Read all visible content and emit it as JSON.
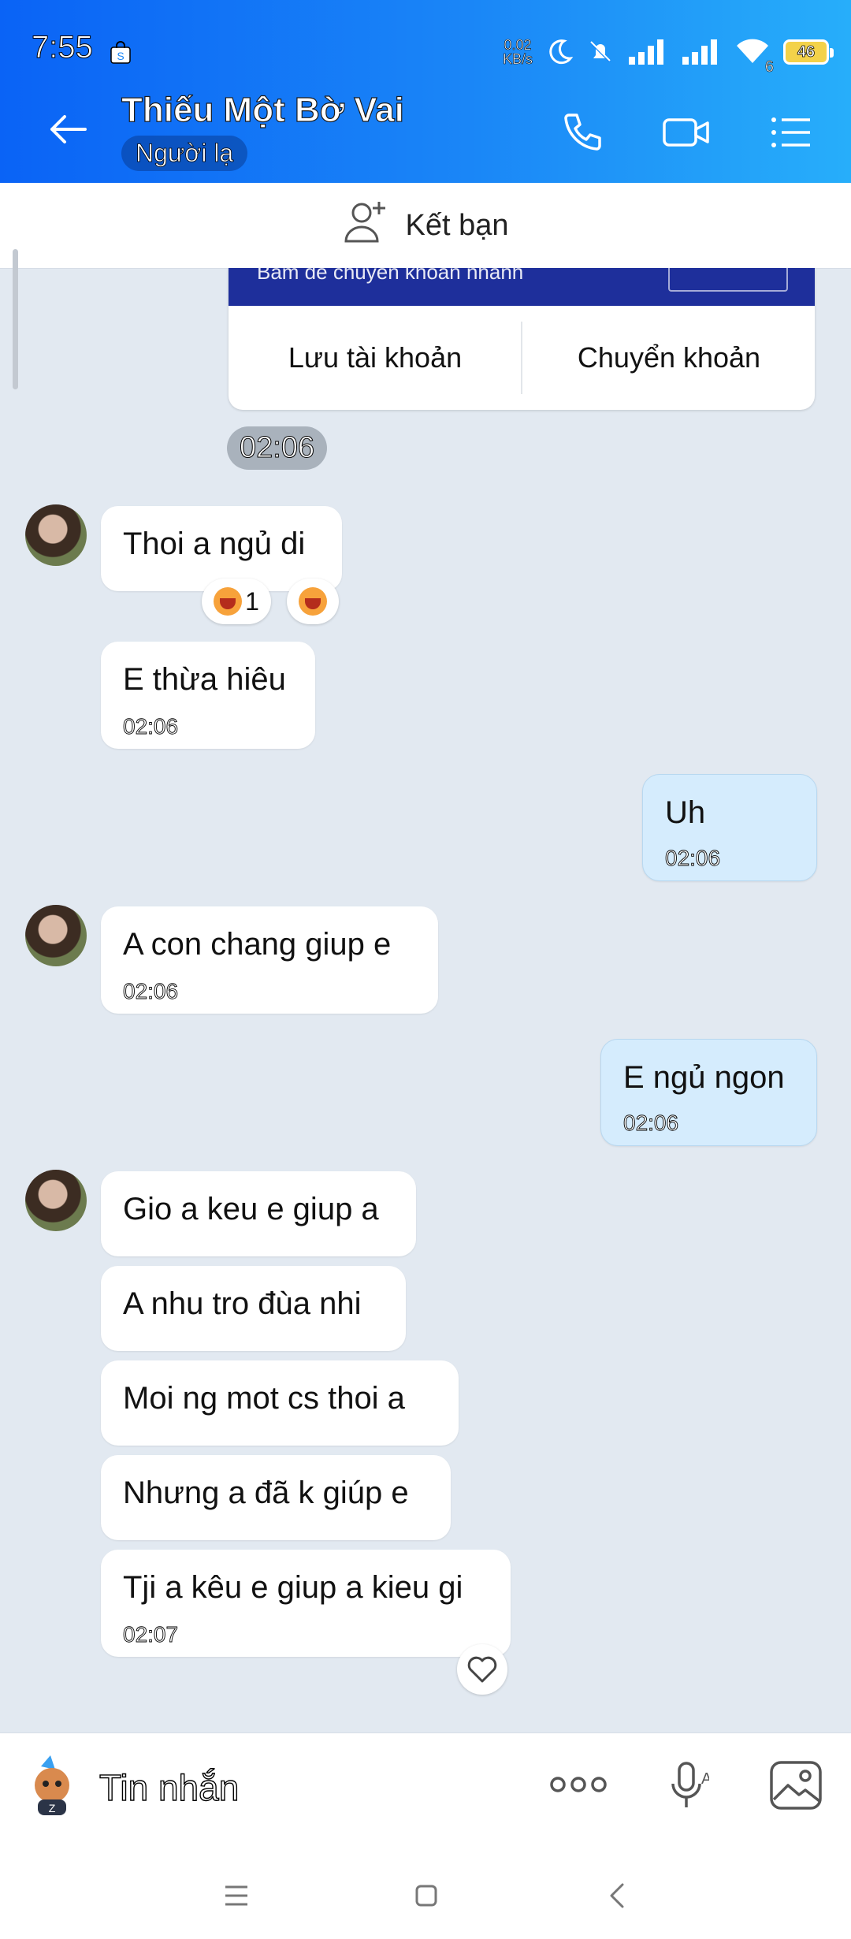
{
  "status": {
    "time": "7:55",
    "net_speed": "0.02",
    "net_unit": "KB/s",
    "wifi_num": "6",
    "battery": "46"
  },
  "header": {
    "title": "Thiếu Một Bờ Vai",
    "subtitle": "Người lạ"
  },
  "add_friend": {
    "label": "Kết bạn"
  },
  "transfer_card": {
    "band_text": "Bấm để chuyển khoản nhanh",
    "save_label": "Lưu tài khoản",
    "transfer_label": "Chuyển khoản"
  },
  "time_pill": "02:06",
  "messages": [
    {
      "text": "Thoi a ngủ di"
    },
    {
      "text": "E thừa hiêu",
      "time": "02:06"
    },
    {
      "text": "Uh",
      "time": "02:06"
    },
    {
      "text": "A con chang giup e",
      "time": "02:06"
    },
    {
      "text": "E ngủ ngon",
      "time": "02:06"
    },
    {
      "text": "Gio a keu e giup a"
    },
    {
      "text": "A nhu tro đùa nhi"
    },
    {
      "text": "Moi ng mot cs thoi a"
    },
    {
      "text": "Nhưng a đã k giúp e"
    },
    {
      "text": "Tji a kêu e giup a kieu gi",
      "time": "02:07"
    }
  ],
  "reactions": {
    "count": "1"
  },
  "composer": {
    "placeholder": "Tin nhắn"
  },
  "colors": {
    "header_start": "#0a63f6",
    "header_end": "#27aefa",
    "chat_bg": "#e2e9f1",
    "my_bubble": "#d5ecfd"
  },
  "icons": [
    "back-arrow-icon",
    "phone-icon",
    "video-icon",
    "menu-list-icon",
    "add-person-icon",
    "heart-icon",
    "more-icon",
    "mic-icon",
    "image-icon",
    "nav-menu-icon",
    "nav-home-icon",
    "nav-back-icon"
  ]
}
